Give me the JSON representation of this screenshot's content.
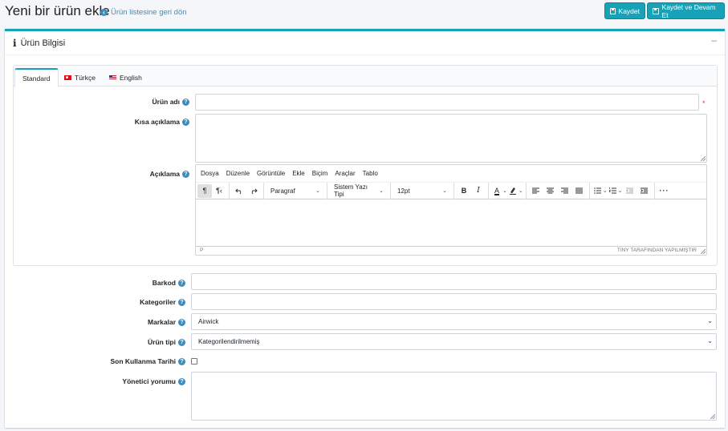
{
  "header": {
    "title": "Yeni bir ürün ekle",
    "back_link": "Ürün listesine geri dön",
    "save_label": "Kaydet",
    "save_continue_label": "Kaydet ve Devam Et"
  },
  "card": {
    "title": "Ürün Bilgisi",
    "collapse_symbol": "–"
  },
  "tabs": [
    {
      "label": "Standard",
      "active": true
    },
    {
      "label": "Türkçe",
      "icon": "turkey-flag-icon"
    },
    {
      "label": "English",
      "icon": "us-flag-icon"
    }
  ],
  "form": {
    "product_name_label": "Ürün adı",
    "product_name_value": "",
    "required_mark": "*",
    "short_desc_label": "Kısa açıklama",
    "short_desc_value": "",
    "description_label": "Açıklama",
    "barcode_label": "Barkod",
    "barcode_value": "",
    "categories_label": "Kategoriler",
    "categories_value": "",
    "brands_label": "Markalar",
    "brands_value": "Airwick",
    "product_type_label": "Ürün tipi",
    "product_type_value": "Kategorilendirilmemiş",
    "expiry_label": "Son Kullanma Tarihi",
    "expiry_checked": false,
    "admin_comment_label": "Yönetici yorumu",
    "admin_comment_value": "",
    "help_symbol": "?"
  },
  "editor": {
    "menus": [
      "Dosya",
      "Düzenle",
      "Görüntüle",
      "Ekle",
      "Biçim",
      "Araçlar",
      "Tablo"
    ],
    "block_format": "Paragraf",
    "font_family": "Sistem Yazı Tipi",
    "font_size": "12pt",
    "bold": "B",
    "italic": "I",
    "status_path": "P",
    "branding": "TINY TARAFINDAN YAPILMIŞTIR"
  },
  "colors": {
    "accent": "#17a2b8",
    "link": "#3c8dbc",
    "required": "#dc3545"
  }
}
